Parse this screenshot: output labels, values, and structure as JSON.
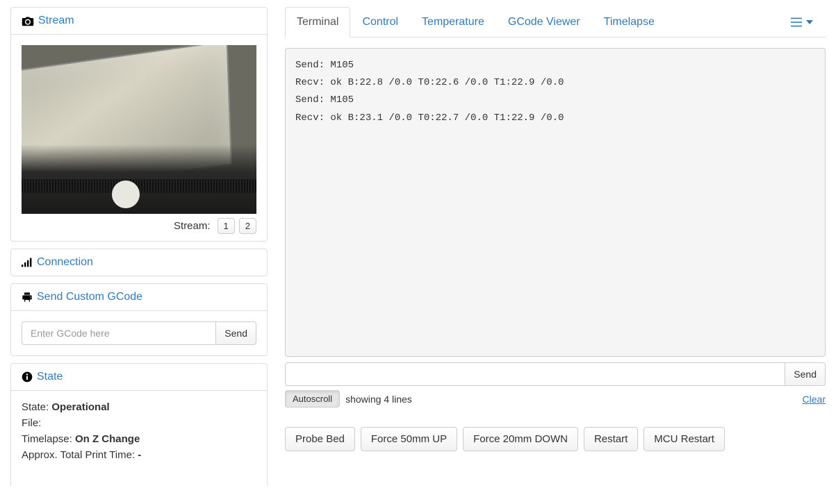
{
  "sidebar": {
    "stream": {
      "title": "Stream",
      "selector_label": "Stream:",
      "buttons": [
        "1",
        "2"
      ]
    },
    "connection": {
      "title": "Connection"
    },
    "gcode": {
      "title": "Send Custom GCode",
      "input_placeholder": "Enter GCode here",
      "send_label": "Send"
    },
    "state": {
      "title": "State",
      "lines": [
        {
          "label": "State:",
          "value": "Operational"
        },
        {
          "label": "File:",
          "value": ""
        },
        {
          "label": "Timelapse:",
          "value": "On Z Change"
        },
        {
          "label": "Approx. Total Print Time:",
          "value": "-"
        }
      ]
    }
  },
  "tabs": [
    {
      "id": "terminal",
      "label": "Terminal",
      "active": true
    },
    {
      "id": "control",
      "label": "Control",
      "active": false
    },
    {
      "id": "temperature",
      "label": "Temperature",
      "active": false
    },
    {
      "id": "gcodeviewer",
      "label": "GCode Viewer",
      "active": false
    },
    {
      "id": "timelapse",
      "label": "Timelapse",
      "active": false
    }
  ],
  "terminal": {
    "lines": [
      "Send: M105",
      "Recv: ok B:22.8 /0.0 T0:22.6 /0.0 T1:22.9 /0.0",
      "Send: M105",
      "Recv: ok B:23.1 /0.0 T0:22.7 /0.0 T1:22.9 /0.0"
    ],
    "send_label": "Send",
    "autoscroll_label": "Autoscroll",
    "showing_text": "showing 4 lines",
    "clear_label": "Clear",
    "actions": [
      "Probe Bed",
      "Force 50mm UP",
      "Force 20mm DOWN",
      "Restart",
      "MCU Restart"
    ]
  }
}
